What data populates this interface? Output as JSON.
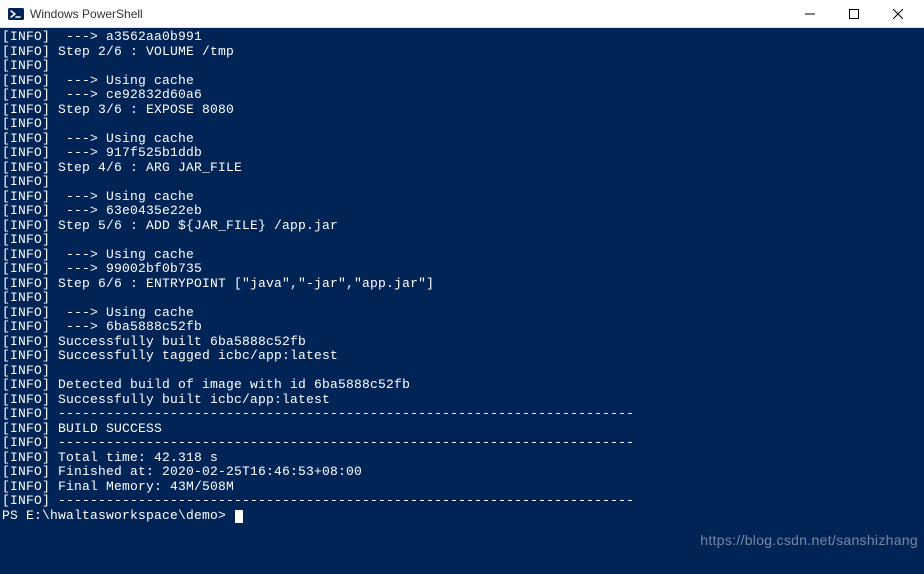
{
  "window": {
    "title": "Windows PowerShell"
  },
  "lines": [
    "[INFO]  ---> a3562aa0b991",
    "[INFO] Step 2/6 : VOLUME /tmp",
    "[INFO]",
    "[INFO]  ---> Using cache",
    "[INFO]  ---> ce92832d60a6",
    "[INFO] Step 3/6 : EXPOSE 8080",
    "[INFO]",
    "[INFO]  ---> Using cache",
    "[INFO]  ---> 917f525b1ddb",
    "[INFO] Step 4/6 : ARG JAR_FILE",
    "[INFO]",
    "[INFO]  ---> Using cache",
    "[INFO]  ---> 63e0435e22eb",
    "[INFO] Step 5/6 : ADD ${JAR_FILE} /app.jar",
    "[INFO]",
    "[INFO]  ---> Using cache",
    "[INFO]  ---> 99002bf0b735",
    "[INFO] Step 6/6 : ENTRYPOINT [\"java\",\"-jar\",\"app.jar\"]",
    "[INFO]",
    "[INFO]  ---> Using cache",
    "[INFO]  ---> 6ba5888c52fb",
    "[INFO] Successfully built 6ba5888c52fb",
    "[INFO] Successfully tagged icbc/app:latest",
    "[INFO]",
    "[INFO] Detected build of image with id 6ba5888c52fb",
    "[INFO] Successfully built icbc/app:latest",
    "[INFO] ------------------------------------------------------------------------",
    "[INFO] BUILD SUCCESS",
    "[INFO] ------------------------------------------------------------------------",
    "[INFO] Total time: 42.318 s",
    "[INFO] Finished at: 2020-02-25T16:46:53+08:00",
    "[INFO] Final Memory: 43M/508M",
    "[INFO] ------------------------------------------------------------------------"
  ],
  "prompt": "PS E:\\hwaltasworkspace\\demo> ",
  "watermark": "https://blog.csdn.net/sanshizhang"
}
